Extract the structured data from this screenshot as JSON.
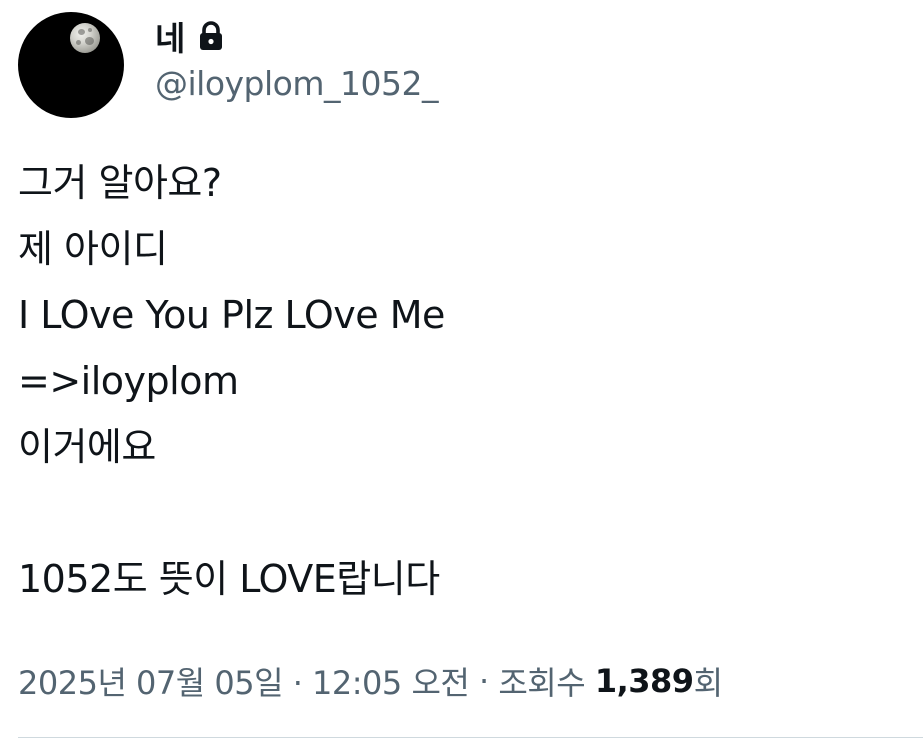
{
  "author": {
    "display_name": "네",
    "handle": "@iloyplom_1052_",
    "avatar_icon": "moon-avatar",
    "protected_icon": "lock-icon"
  },
  "tweet": {
    "lines": [
      "그거 알아요?",
      "제 아이디",
      "I LOve You Plz LOve Me",
      "=>iloyplom",
      "이거에요",
      "",
      "1052도 뜻이 LOVE랍니다"
    ]
  },
  "meta": {
    "timestamp": "2025년 07월 05일 · 12:05 오전",
    "separator": " · ",
    "views_label": "조회수 ",
    "views_count": "1,389",
    "views_suffix": "회"
  },
  "colors": {
    "text_primary": "#0f1419",
    "text_secondary": "#536471",
    "divider": "#cfd9de",
    "background": "#ffffff"
  }
}
